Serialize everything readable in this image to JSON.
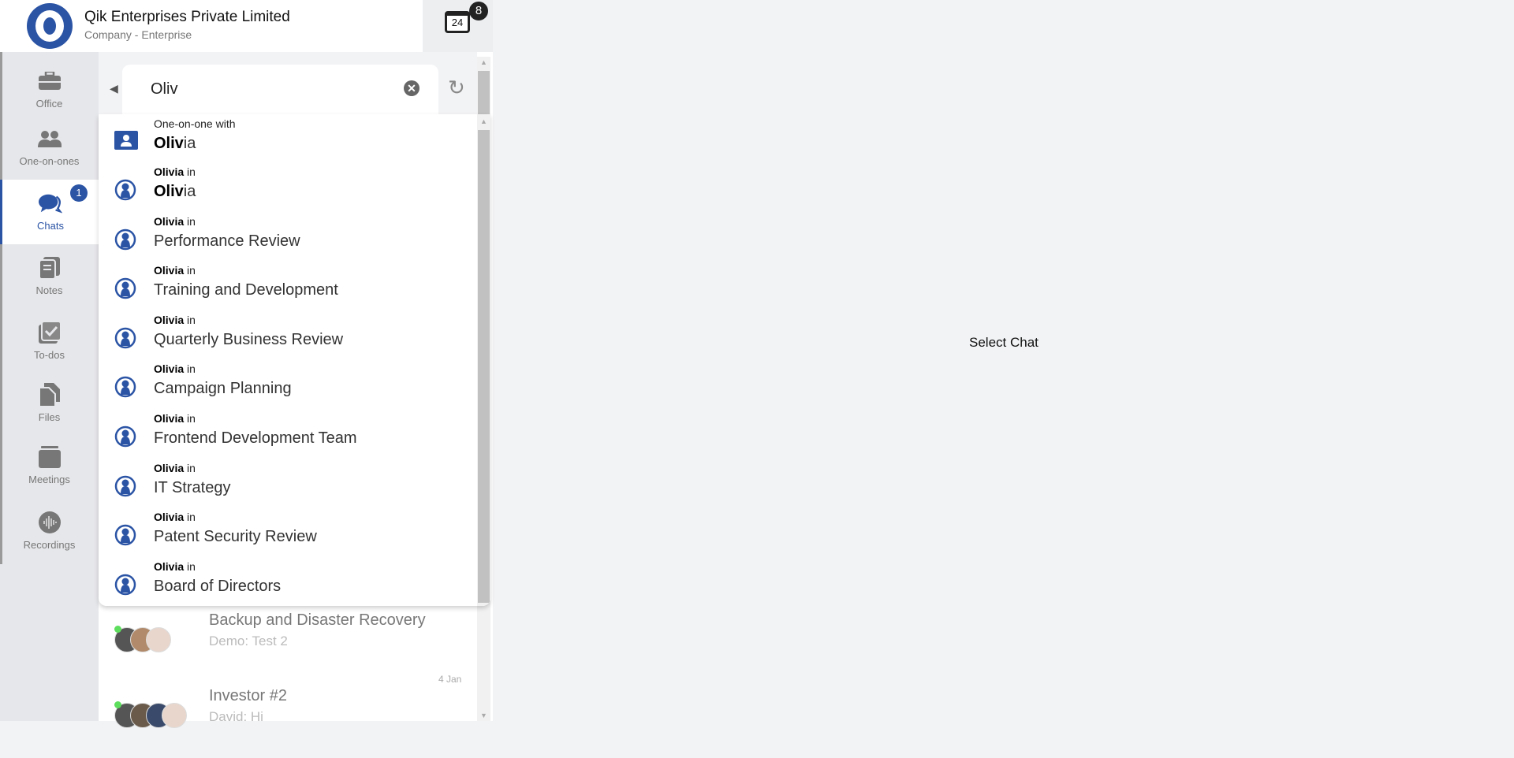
{
  "header": {
    "title": "Qik Enterprises Private Limited",
    "subtitle": "Company - Enterprise",
    "calendar_day": "24",
    "calendar_badge": "8"
  },
  "sidebar": {
    "items": [
      {
        "label": "Office",
        "icon": "briefcase-icon"
      },
      {
        "label": "One-on-ones",
        "icon": "users-icon"
      },
      {
        "label": "Chats",
        "icon": "chat-icon",
        "badge": "1",
        "active": true
      },
      {
        "label": "Notes",
        "icon": "notes-icon"
      },
      {
        "label": "To-dos",
        "icon": "checkbox-icon"
      },
      {
        "label": "Files",
        "icon": "files-icon"
      },
      {
        "label": "Meetings",
        "icon": "calendar-icon"
      },
      {
        "label": "Recordings",
        "icon": "audio-wave-icon"
      }
    ]
  },
  "search": {
    "value": "Oliv"
  },
  "results": [
    {
      "prefix": "One-on-one with",
      "match": "Oliv",
      "rest": "ia",
      "type": "one-on-one"
    },
    {
      "who": "Olivia",
      "in": " in",
      "match": "Oliv",
      "rest": "ia"
    },
    {
      "who": "Olivia",
      "in": " in",
      "name": "Performance Review"
    },
    {
      "who": "Olivia",
      "in": " in",
      "name": "Training and Development"
    },
    {
      "who": "Olivia",
      "in": " in",
      "name": "Quarterly Business Review"
    },
    {
      "who": "Olivia",
      "in": " in",
      "name": "Campaign Planning"
    },
    {
      "who": "Olivia",
      "in": " in",
      "name": "Frontend Development Team"
    },
    {
      "who": "Olivia",
      "in": " in",
      "name": "IT Strategy"
    },
    {
      "who": "Olivia",
      "in": " in",
      "name": "Patent Security Review"
    },
    {
      "who": "Olivia",
      "in": " in",
      "name": "Board of Directors"
    }
  ],
  "chats": [
    {
      "title": "Backup and Disaster Recovery",
      "subtitle": "Demo: Test 2",
      "date": ""
    },
    {
      "title": "Investor #2",
      "subtitle": "David: Hi",
      "date": "4 Jan"
    }
  ],
  "main": {
    "placeholder": "Select Chat"
  },
  "colors": {
    "accent": "#2b54a5",
    "online": "#5dde5d"
  }
}
